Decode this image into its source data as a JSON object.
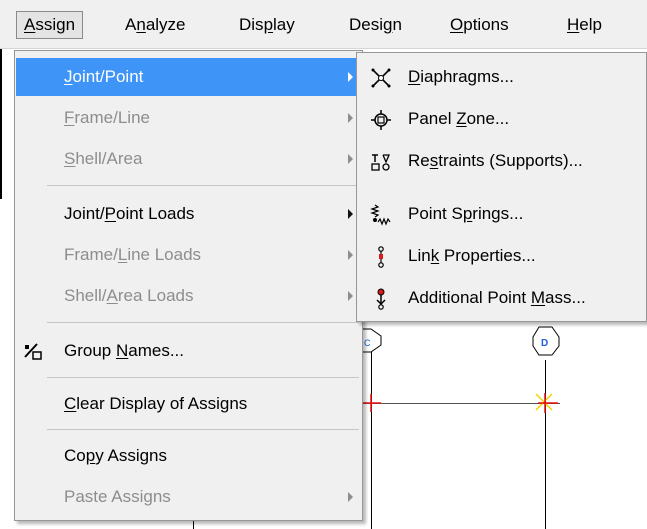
{
  "menubar": {
    "items": [
      {
        "pre": "",
        "u": "A",
        "post": "ssign"
      },
      {
        "pre": "A",
        "u": "n",
        "post": "alyze"
      },
      {
        "pre": "Dis",
        "u": "p",
        "post": "lay"
      },
      {
        "pre": "Desi",
        "u": "g",
        "post": "n"
      },
      {
        "pre": "",
        "u": "O",
        "post": "ptions"
      },
      {
        "pre": "",
        "u": "H",
        "post": "elp"
      }
    ]
  },
  "canvas": {
    "grid_labels": [
      "C",
      "D"
    ]
  },
  "assign_menu": {
    "items": [
      {
        "pre": "",
        "u": "J",
        "post": "oint/Point",
        "state": "highlighted",
        "submenu": true
      },
      {
        "pre": "",
        "u": "F",
        "post": "rame/Line",
        "state": "disabled",
        "submenu": true
      },
      {
        "pre": "",
        "u": "S",
        "post": "hell/Area",
        "state": "disabled",
        "submenu": true
      },
      {
        "pre": "Joint/",
        "u": "P",
        "post": "oint Loads",
        "state": "enabled",
        "submenu": true
      },
      {
        "pre": "Frame/",
        "u": "L",
        "post": "ine Loads",
        "state": "disabled",
        "submenu": true
      },
      {
        "pre": "Shell/",
        "u": "A",
        "post": "rea Loads",
        "state": "disabled",
        "submenu": true
      },
      {
        "pre": "Group ",
        "u": "N",
        "post": "ames...",
        "state": "enabled",
        "submenu": false,
        "icon": "group-names-icon"
      },
      {
        "pre": "",
        "u": "C",
        "post": "lear Display of Assigns",
        "state": "enabled",
        "submenu": false
      },
      {
        "pre": "Co",
        "u": "p",
        "post": "y Assigns",
        "state": "enabled",
        "submenu": false
      },
      {
        "pre": "Paste Assigns",
        "u": "",
        "post": "",
        "state": "disabled",
        "submenu": true
      }
    ]
  },
  "joint_point_submenu": {
    "items": [
      {
        "pre": "",
        "u": "D",
        "post": "iaphragms...",
        "icon": "diaphragm-icon"
      },
      {
        "pre": "Panel ",
        "u": "Z",
        "post": "one...",
        "icon": "panel-zone-icon"
      },
      {
        "pre": "Re",
        "u": "s",
        "post": "traints (Supports)...",
        "icon": "restraints-icon"
      },
      {
        "pre": "Point S",
        "u": "p",
        "post": "rings...",
        "icon": "point-springs-icon"
      },
      {
        "pre": "Lin",
        "u": "k",
        "post": " Properties...",
        "icon": "link-properties-icon"
      },
      {
        "pre": "Additional Point ",
        "u": "M",
        "post": "ass...",
        "icon": "point-mass-icon"
      }
    ]
  }
}
